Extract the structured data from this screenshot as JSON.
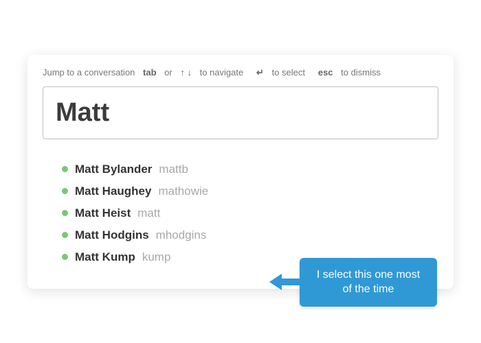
{
  "hints": {
    "label": "Jump to a conversation",
    "tab_key": "tab",
    "or_word": "or",
    "arrows": "↑ ↓",
    "navigate_word": "to navigate",
    "enter_key": "↵",
    "select_word": "to select",
    "esc_key": "esc",
    "dismiss_word": "to dismiss"
  },
  "search": {
    "value": "Matt"
  },
  "results": [
    {
      "display_name": "Matt Bylander",
      "username": "mattb"
    },
    {
      "display_name": "Matt Haughey",
      "username": "mathowie"
    },
    {
      "display_name": "Matt Heist",
      "username": "matt"
    },
    {
      "display_name": "Matt Hodgins",
      "username": "mhodgins"
    },
    {
      "display_name": "Matt Kump",
      "username": "kump"
    }
  ],
  "callout": {
    "text": "I select this one most of the time",
    "color": "#2f99d6"
  }
}
